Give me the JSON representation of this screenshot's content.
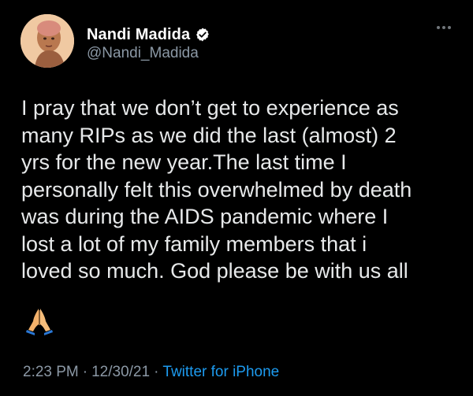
{
  "tweet": {
    "author": {
      "display_name": "Nandi Madida",
      "handle": "@Nandi_Madida",
      "verified": true
    },
    "text": "I pray that we don’t get to experience as\nmany RIPs as we did the last (almost) 2\nyrs for the new year.The last time I\npersonally felt this overwhelmed by death\nwas during the AIDS pandemic where I\nlost a lot of my family members that i\nloved so much. God please be with us all",
    "emoji_icon": "folded-hands-icon",
    "time": "2:23 PM",
    "date": "12/30/21",
    "source": "Twitter for iPhone",
    "separator": "·"
  },
  "colors": {
    "background": "#000000",
    "text": "#e7e9ea",
    "secondary": "#8b98a5",
    "link": "#1d9bf0",
    "verified": "#ffffff"
  }
}
